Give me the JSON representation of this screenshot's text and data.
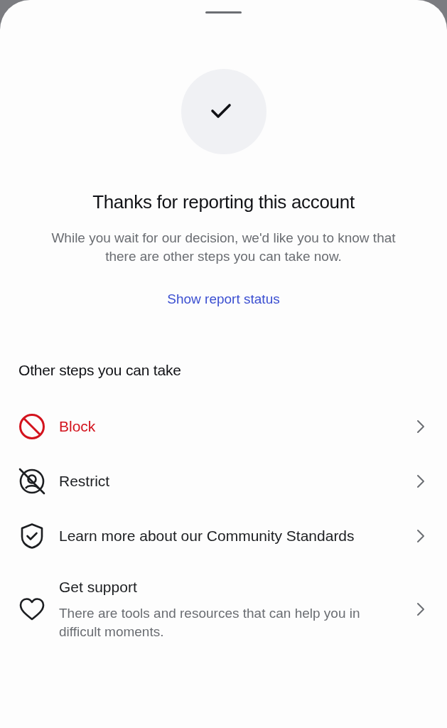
{
  "confirmation": {
    "title": "Thanks for reporting this account",
    "message": "While you wait for our decision, we'd like you to know that there are other steps you can take now.",
    "link": "Show report status"
  },
  "steps": {
    "heading": "Other steps you can take",
    "items": [
      {
        "kind": "block",
        "label": "Block",
        "destructive": true
      },
      {
        "kind": "restrict",
        "label": "Restrict",
        "destructive": false
      },
      {
        "kind": "standards",
        "label": "Learn more about our Community Standards",
        "destructive": false
      },
      {
        "kind": "support",
        "label": "Get support",
        "description": "There are tools and resources that can help you in difficult moments.",
        "destructive": false
      }
    ]
  }
}
